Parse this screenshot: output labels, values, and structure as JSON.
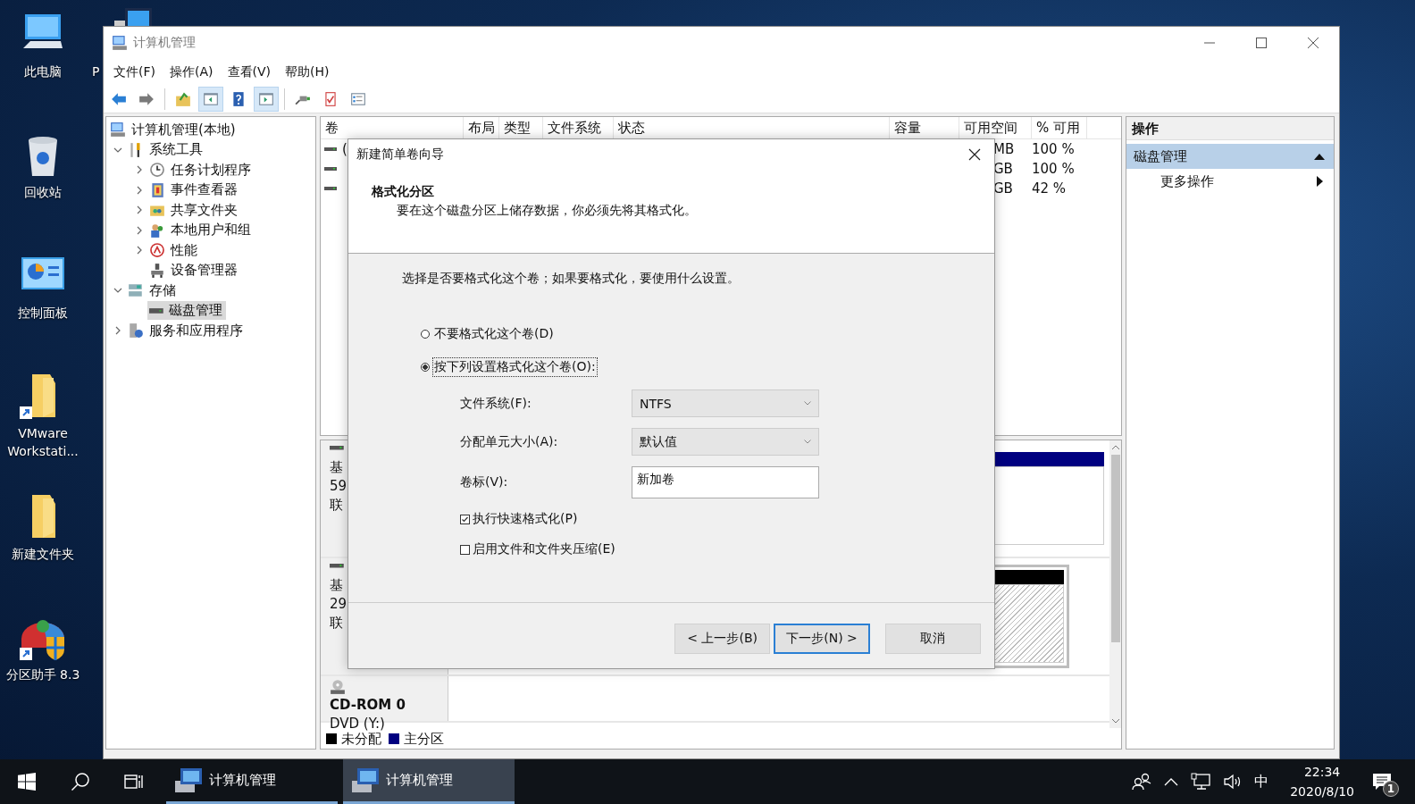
{
  "desktop_icons": [
    {
      "label": "此电脑",
      "kind": "computer",
      "shortcut": false
    },
    {
      "label": "回收站",
      "kind": "recycle",
      "shortcut": false
    },
    {
      "label": "控制面板",
      "kind": "control",
      "shortcut": false
    },
    {
      "label": "VMware Workstati...",
      "kind": "folder",
      "shortcut": true
    },
    {
      "label": "新建文件夹",
      "kind": "folder",
      "shortcut": false
    },
    {
      "label": "分区助手 8.3",
      "kind": "partition",
      "shortcut": true
    }
  ],
  "desktop_icon_column_2": {
    "label": "P",
    "kind": "monitor"
  },
  "window": {
    "title": "计算机管理",
    "menu": [
      "文件(F)",
      "操作(A)",
      "查看(V)",
      "帮助(H)"
    ],
    "toolbar": [
      [
        {
          "kind": "back",
          "pressed": false
        },
        {
          "kind": "forward",
          "pressed": false
        }
      ],
      [
        {
          "kind": "up",
          "pressed": false
        },
        {
          "kind": "tree",
          "pressed": true
        },
        {
          "kind": "help",
          "pressed": false
        },
        {
          "kind": "pane",
          "pressed": true
        }
      ],
      [
        {
          "kind": "connect",
          "pressed": false
        },
        {
          "kind": "checklist",
          "pressed": false
        },
        {
          "kind": "properties",
          "pressed": false
        }
      ]
    ],
    "tree": [
      {
        "label": "计算机管理(本地)",
        "kind": "computer",
        "selected": false,
        "children": [
          {
            "label": "系统工具",
            "kind": "tools",
            "expanded": true,
            "selected": false,
            "children": [
              {
                "label": "任务计划程序",
                "kind": "clock",
                "expanded": false,
                "selected": false
              },
              {
                "label": "事件查看器",
                "kind": "event",
                "expanded": false,
                "selected": false
              },
              {
                "label": "共享文件夹",
                "kind": "share",
                "expanded": false,
                "selected": false
              },
              {
                "label": "本地用户和组",
                "kind": "users",
                "expanded": false,
                "selected": false
              },
              {
                "label": "性能",
                "kind": "perf",
                "expanded": false,
                "selected": false
              },
              {
                "label": "设备管理器",
                "kind": "device",
                "selected": false
              }
            ]
          },
          {
            "label": "存储",
            "kind": "storage",
            "expanded": true,
            "selected": false,
            "children": [
              {
                "label": "磁盘管理",
                "kind": "disk",
                "selected": true
              }
            ]
          },
          {
            "label": "服务和应用程序",
            "kind": "services",
            "expanded": false,
            "selected": false
          }
        ]
      }
    ],
    "volume_table": {
      "columns": [
        "卷",
        "布局",
        "类型",
        "文件系统",
        "状态",
        "容量",
        "可用空间",
        "% 可用"
      ],
      "rows": [
        {
          "volume": "(",
          "free": "MB",
          "percent": "100 %"
        },
        {
          "free": "GB",
          "percent": "100 %"
        },
        {
          "free": "GB",
          "percent": "42 %"
        }
      ]
    },
    "disk_view": {
      "disks": [
        {
          "kind": "basic",
          "name": "基",
          "size": "59",
          "status": "联",
          "partition": {
            "kind": "primary",
            "selected": false
          }
        },
        {
          "kind": "basic",
          "name": "基",
          "size": "29",
          "status": "联",
          "partition": {
            "kind": "unallocated",
            "selected": true
          }
        },
        {
          "kind": "cdrom",
          "name": "CD-ROM 0",
          "size": "DVD (Y:)"
        }
      ],
      "legend": [
        {
          "label": "未分配",
          "kind": "unallocated",
          "color": "#000000"
        },
        {
          "label": "主分区",
          "kind": "primary",
          "color": "#000080"
        }
      ]
    },
    "actions": {
      "title": "操作",
      "section": "磁盘管理",
      "expanded": true,
      "items": [
        "更多操作"
      ]
    }
  },
  "dialog": {
    "title": "新建简单卷向导",
    "heading": "格式化分区",
    "subheading": "要在这个磁盘分区上储存数据，你必须先将其格式化。",
    "prompt": "选择是否要格式化这个卷；如果要格式化，要使用什么设置。",
    "options": [
      {
        "label": "不要格式化这个卷(D)",
        "selected": false
      },
      {
        "label": "按下列设置格式化这个卷(O):",
        "selected": true
      }
    ],
    "settings": [
      {
        "label": "文件系统(F):",
        "kind": "dropdown",
        "value": "NTFS"
      },
      {
        "label": "分配单元大小(A):",
        "kind": "dropdown",
        "value": "默认值"
      },
      {
        "label": "卷标(V):",
        "kind": "text",
        "value": "新加卷"
      }
    ],
    "checkboxes": [
      {
        "label": "执行快速格式化(P)",
        "checked": true
      },
      {
        "label": "启用文件和文件夹压缩(E)",
        "checked": false
      }
    ],
    "buttons": [
      {
        "label": "< 上一步(B)",
        "default": false
      },
      {
        "label": "下一步(N) >",
        "default": true
      },
      {
        "label": "取消",
        "default": false
      }
    ]
  },
  "taskbar": {
    "apps": [
      {
        "label": "计算机管理",
        "active": false
      },
      {
        "label": "计算机管理",
        "active": true
      }
    ],
    "ime": "中",
    "time": "22:34",
    "date": "2020/8/10",
    "notification_count": "1"
  }
}
